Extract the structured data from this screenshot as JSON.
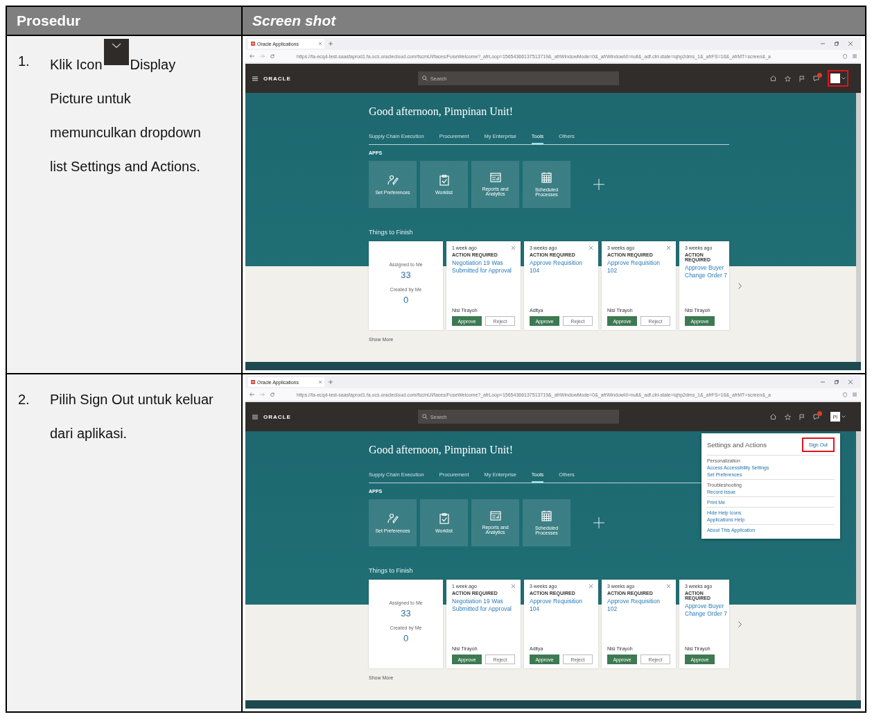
{
  "header": {
    "column_1": "Prosedur",
    "column_2": "Screen shot"
  },
  "steps": [
    {
      "number": "1.",
      "text_before_icon": "Klik Icon",
      "text_after_icon": "Display",
      "text_continued": "Picture untuk memunculkan dropdown list Settings and Actions.",
      "screenshot": {
        "tab_title": "Oracle Applications",
        "url": "https://fa-ecqd-test-saasfaprod1.fa.ocs.oraclecloud.com/fscmUI/faces/FuseWelcome?_afrLoop=15654366137513719&_afrWindowMode=0&_afrWindowId=null&_adf.ctrl-state=iqhp2dms_1&_afrFS=16&_afrMT=screen&_a",
        "brand": "ORACLE",
        "search_placeholder": "Search",
        "avatar": {
          "highlighted": true
        },
        "greeting": "Good afternoon, Pimpinan Unit!",
        "nav_tabs": [
          {
            "label": "Supply Chain Execution",
            "selected": false
          },
          {
            "label": "Procurement",
            "selected": false
          },
          {
            "label": "My Enterprise",
            "selected": false
          },
          {
            "label": "Tools",
            "selected": true
          },
          {
            "label": "Others",
            "selected": false
          }
        ],
        "apps_label": "APPS",
        "apps": [
          {
            "kind": "preferences",
            "label": "Set Preferences"
          },
          {
            "kind": "worklist",
            "label": "Worklist"
          },
          {
            "kind": "reports",
            "label": "Reports and Analytics"
          },
          {
            "kind": "calendar",
            "label": "Scheduled Processes"
          }
        ],
        "section_title": "Things to Finish",
        "summary": {
          "assigned_label": "Assigned to Me",
          "assigned_count": "33",
          "created_label": "Created by Me",
          "created_count": "0"
        },
        "tasks": [
          {
            "age": "1 week ago",
            "status": "ACTION REQUIRED",
            "title": "Negotiation 19 Was Submitted for Approval",
            "person": "Nisi Tirayoh",
            "approve": "Approve",
            "reject": "Reject",
            "partial": false
          },
          {
            "age": "3 weeks ago",
            "status": "ACTION REQUIRED",
            "title": "Approve Requisition 104",
            "person": "Aditya",
            "approve": "Approve",
            "reject": "Reject",
            "partial": false
          },
          {
            "age": "3 weeks ago",
            "status": "ACTION REQUIRED",
            "title": "Approve Requisition 102",
            "person": "Nisi Tirayoh",
            "approve": "Approve",
            "reject": "Reject",
            "partial": false
          },
          {
            "age": "3 weeks ago",
            "status": "ACTION REQUIRED",
            "title": "Approve Buyer Change Order 7",
            "person": "Nisi Tirayoh",
            "approve": "Approve",
            "partial": true
          }
        ],
        "show_more": "Show More"
      }
    },
    {
      "number": "2.",
      "text": "Pilih Sign Out untuk keluar dari aplikasi.",
      "screenshot": {
        "tab_title": "Oracle Applications",
        "url": "https://fa-ecqd-test-saasfaprod1.fa.ocs.oraclecloud.com/fscmUI/faces/FuseWelcome?_afrLoop=15654366137513719&_afrWindowMode=0&_afrWindowId=null&_adf.ctrl-state=iqhp2dms_1&_afrFS=16&_afrMT=screen&_a",
        "brand": "ORACLE",
        "search_placeholder": "Search",
        "avatar": {
          "initials": "PI",
          "highlighted": false
        },
        "greeting": "Good afternoon, Pimpinan Unit!",
        "nav_tabs": [
          {
            "label": "Supply Chain Execution",
            "selected": false
          },
          {
            "label": "Procurement",
            "selected": false
          },
          {
            "label": "My Enterprise",
            "selected": false
          },
          {
            "label": "Tools",
            "selected": true
          },
          {
            "label": "Others",
            "selected": false
          }
        ],
        "apps_label": "APPS",
        "apps": [
          {
            "kind": "preferences",
            "label": "Set Preferences"
          },
          {
            "kind": "worklist",
            "label": "Worklist"
          },
          {
            "kind": "reports",
            "label": "Reports and Analytics"
          },
          {
            "kind": "calendar",
            "label": "Scheduled Processes"
          }
        ],
        "section_title": "Things to Finish",
        "summary": {
          "assigned_label": "Assigned to Me",
          "assigned_count": "33",
          "created_label": "Created by Me",
          "created_count": "0"
        },
        "tasks": [
          {
            "age": "1 week ago",
            "status": "ACTION REQUIRED",
            "title": "Negotiation 19 Was Submitted for Approval",
            "person": "Nisi Tirayoh",
            "approve": "Approve",
            "reject": "Reject",
            "partial": false
          },
          {
            "age": "3 weeks ago",
            "status": "ACTION REQUIRED",
            "title": "Approve Requisition 104",
            "person": "Aditya",
            "approve": "Approve",
            "reject": "Reject",
            "partial": false
          },
          {
            "age": "3 weeks ago",
            "status": "ACTION REQUIRED",
            "title": "Approve Requisition 102",
            "person": "Nisi Tirayoh",
            "approve": "Approve",
            "reject": "Reject",
            "partial": false
          },
          {
            "age": "3 weeks ago",
            "status": "ACTION REQUIRED",
            "title": "Approve Buyer Change Order 7",
            "person": "Nisi Tirayoh",
            "approve": "Approve",
            "partial": true
          }
        ],
        "show_more": "Show More",
        "menu": {
          "title": "Settings and Actions",
          "sign_out": {
            "label": "Sign Out",
            "highlighted": true
          },
          "groups": [
            {
              "heading": "Personalization",
              "items": [
                "Access Accessibility Settings",
                "Set Preferences"
              ]
            },
            {
              "heading": "Troubleshooting",
              "items": [
                "Record Issue"
              ]
            },
            {
              "items": [
                "Print Me"
              ]
            },
            {
              "items": [
                "Hide Help Icons",
                "Applications Help"
              ]
            },
            {
              "items": [
                "About This Application"
              ]
            }
          ]
        }
      }
    }
  ]
}
